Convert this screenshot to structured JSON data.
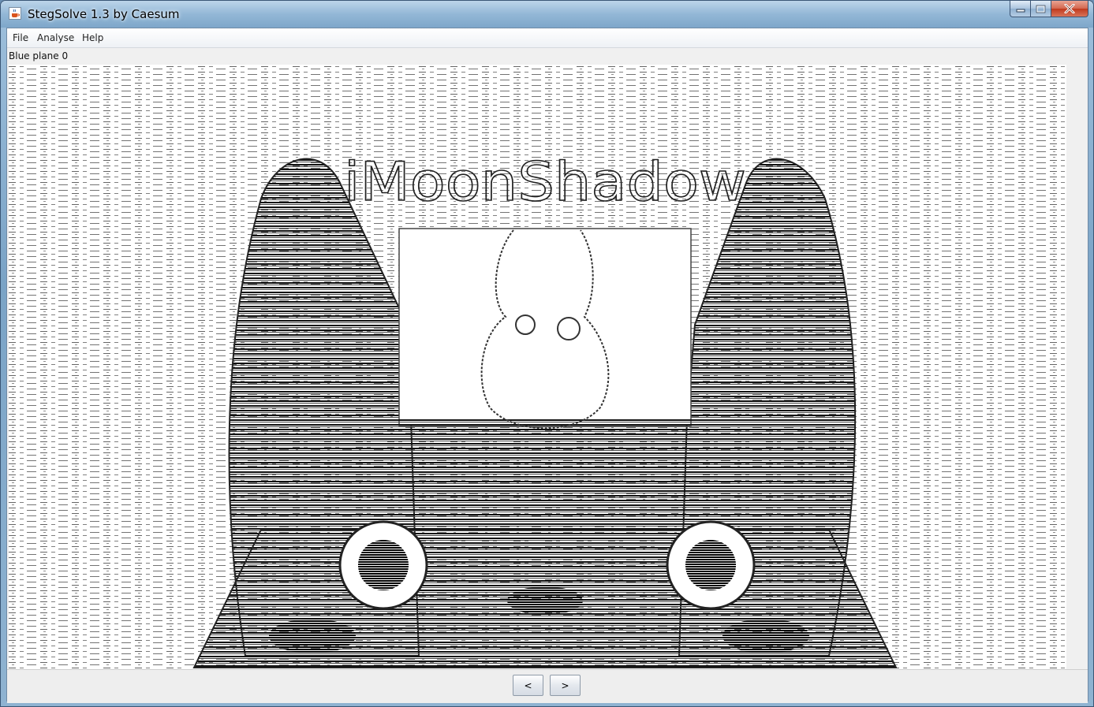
{
  "window": {
    "title": "StegSolve 1.3 by Caesum",
    "icon": "java-cup-icon",
    "controls": {
      "minimize": "minimize-icon",
      "maximize": "maximize-icon",
      "close": "close-icon"
    }
  },
  "menu": {
    "items": [
      {
        "label": "File"
      },
      {
        "label": "Analyse"
      },
      {
        "label": "Help"
      }
    ]
  },
  "view": {
    "plane_label": "Blue plane 0",
    "image_text": "iMoonShadow"
  },
  "navigation": {
    "prev_label": "<",
    "next_label": ">"
  },
  "colors": {
    "titlebar": "#93b7d6",
    "client_bg": "#f0f0f0",
    "image_bg": "#ffffff",
    "noise": "#000000"
  }
}
